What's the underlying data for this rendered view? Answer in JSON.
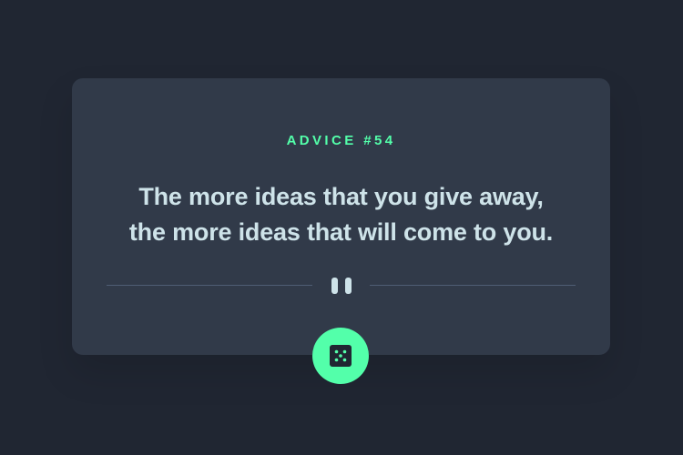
{
  "card": {
    "advice_id": "ADVICE #54",
    "quote_line_1": "The more ideas that you give away,",
    "quote_line_2": "the more ideas that will come to you."
  },
  "icons": {
    "divider": "pause-icon",
    "button": "dice-icon"
  },
  "colors": {
    "background": "#202632",
    "card": "#313a49",
    "accent": "#53ffaa",
    "text": "#cee3e9",
    "divider": "#4f5d74"
  }
}
